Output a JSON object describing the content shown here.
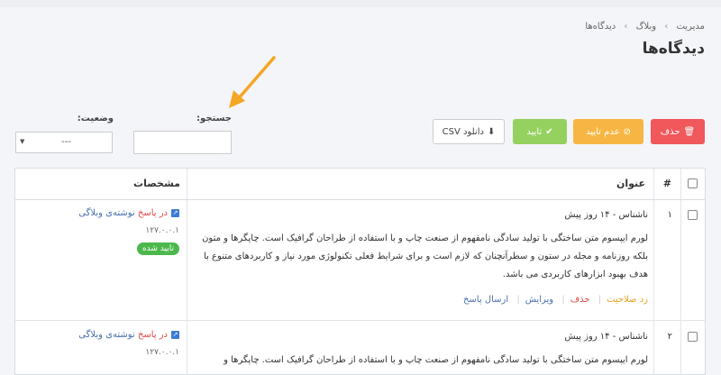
{
  "breadcrumb": {
    "items": [
      "مدیریت",
      "وبلاگ",
      "دیدگاه‌ها"
    ],
    "separator": "›"
  },
  "page_title": "دیدگاه‌ها",
  "toolbar": {
    "delete_label": "حذف",
    "reject_label": "عدم تایید",
    "approve_label": "تایید",
    "csv_label": "دانلود CSV"
  },
  "filters": {
    "search_label": "جستجو:",
    "search_value": "",
    "status_label": "وضعیت:",
    "status_value": "---"
  },
  "table": {
    "headers": {
      "num": "#",
      "title": "عنوان",
      "details": "مشخصات"
    },
    "rows": [
      {
        "num": "۱",
        "author": "ناشناس - ۱۴ روز پیش",
        "body": "لورم ایپسوم متن ساختگی با تولید سادگی نامفهوم از صنعت چاپ و با استفاده از طراحان گرافیک است. چاپگرها و متون بلکه روزنامه و مجله در ستون و سطرآنچنان که لازم است و برای شرایط فعلی تکنولوژی مورد نیاز و کاربردهای متنوع با هدف بهبود ابزارهای کاربردی می باشد.",
        "actions": {
          "unapprove": "رد صلاحیت",
          "delete": "حذف",
          "edit": "ویرایش",
          "reply": "ارسال پاسخ"
        },
        "reply_prefix": "در پاسخ",
        "reply_target": "نوشته‌ی وبلاگی",
        "ip": "۱۲۷.۰.۰.۱",
        "status_badge": "تایید شده"
      },
      {
        "num": "۲",
        "author": "ناشناس - ۱۴ روز پیش",
        "body": "لورم ایپسوم متن ساختگی با تولید سادگی نامفهوم از صنعت چاپ و با استفاده از طراحان گرافیک است. چاپگرها و",
        "reply_prefix": "در پاسخ",
        "reply_target": "نوشته‌ی وبلاگی",
        "ip": "۱۲۷.۰.۰.۱"
      }
    ]
  },
  "colors": {
    "delete": "#f0585b",
    "reject": "#f7b644",
    "approve": "#94d15f",
    "annotation_arrow": "#f5a623",
    "badge_approved": "#4cb84c"
  },
  "icons": {
    "delete": "trash-icon",
    "reject": "ban-icon",
    "approve": "check-icon",
    "csv": "download-icon",
    "external": "external-link-icon"
  }
}
